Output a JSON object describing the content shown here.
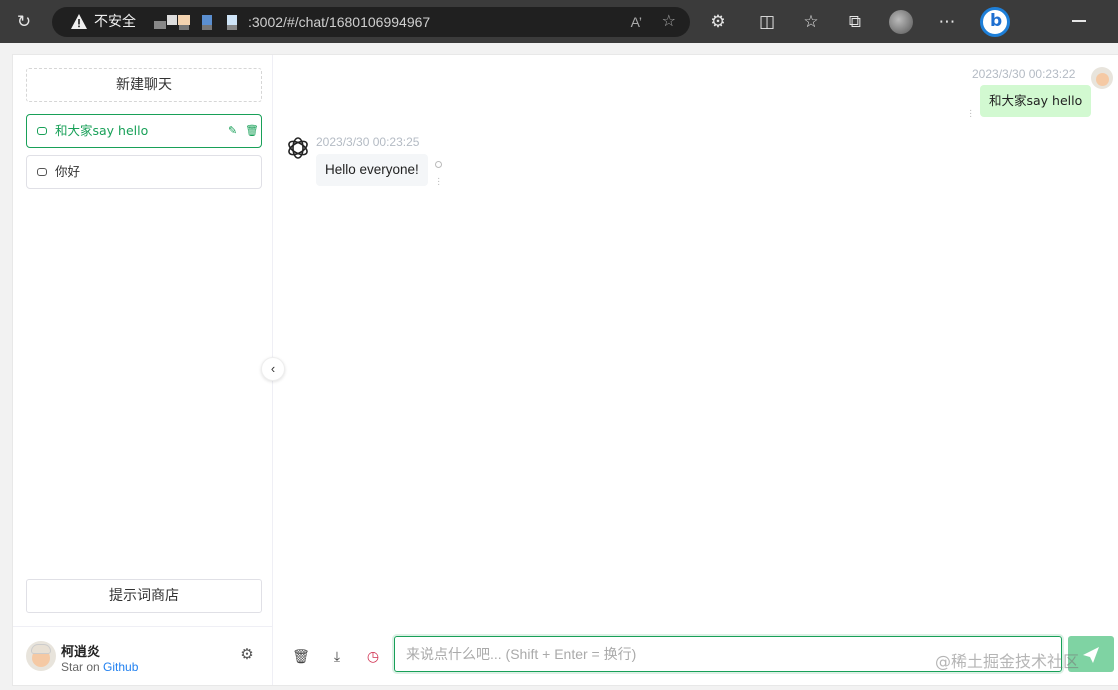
{
  "browser": {
    "security_label": "不安全",
    "url": ":3002/#/chat/1680106994967"
  },
  "sidebar": {
    "new_chat_label": "新建聊天",
    "history": [
      {
        "title": "和大家say hello",
        "active": true
      },
      {
        "title": "你好",
        "active": false
      }
    ],
    "prompt_store_label": "提示词商店",
    "user": {
      "name": "柯逍炎",
      "subtitle_prefix": "Star on",
      "subtitle_link": "Github"
    }
  },
  "chat": {
    "messages": [
      {
        "role": "user",
        "time": "2023/3/30 00:23:22",
        "text": "和大家say hello"
      },
      {
        "role": "assistant",
        "time": "2023/3/30 00:23:25",
        "text": "Hello everyone!"
      }
    ],
    "input_placeholder": "来说点什么吧... (Shift + Enter = 换行)"
  },
  "watermark": "@稀土掘金技术社区",
  "colors": {
    "accent": "#18a058",
    "user_bubble": "#d2f9d1",
    "bot_bubble": "#f4f6f8",
    "send_button": "#7fd3a3"
  },
  "icons": [
    "refresh-icon",
    "warning-icon",
    "read-aloud-icon",
    "favorite-add-icon",
    "extensions-icon",
    "split-screen-icon",
    "favorites-icon",
    "collections-icon",
    "more-icon",
    "bing-icon",
    "chat-bubble-icon",
    "edit-icon",
    "delete-icon",
    "settings-icon",
    "chevron-left-icon",
    "openai-icon",
    "trash-icon",
    "download-icon",
    "history-icon",
    "send-icon"
  ]
}
